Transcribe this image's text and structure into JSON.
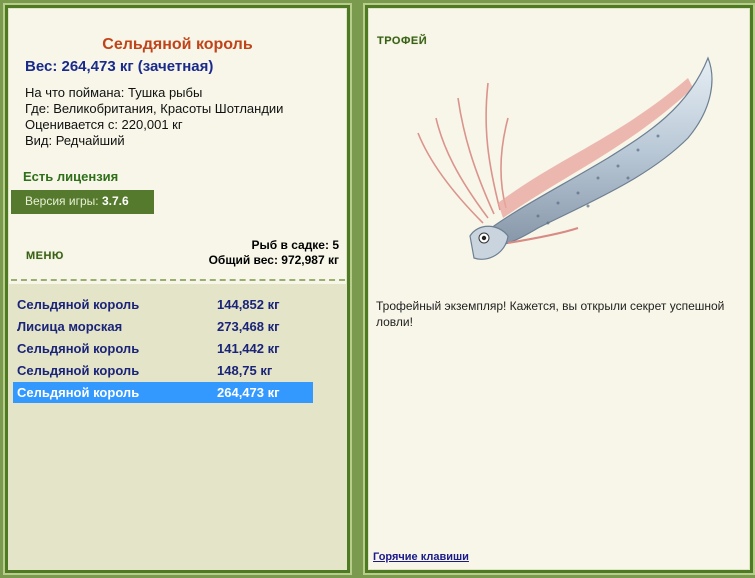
{
  "fish": {
    "name": "Сельдяной король",
    "weight": "Вес: 264,473 кг (зачетная)",
    "bait": "На что поймана: Тушка рыбы",
    "location": "Где: Великобритания, Красоты Шотландии",
    "value": "Оценивается с: 220,001 кг",
    "rarity": "Вид: Редчайший"
  },
  "license": "Есть лицензия",
  "version": {
    "label": "Версия игры:",
    "number": "3.7.6"
  },
  "menu_label": "МЕНЮ",
  "net": {
    "count": "Рыб в садке: 5",
    "total": "Общий вес: 972,987 кг"
  },
  "catches": [
    {
      "name": "Сельдяной король",
      "weight": "144,852 кг"
    },
    {
      "name": "Лисица морская",
      "weight": "273,468 кг"
    },
    {
      "name": "Сельдяной король",
      "weight": "141,442 кг"
    },
    {
      "name": "Сельдяной король",
      "weight": "148,75 кг"
    },
    {
      "name": "Сельдяной король",
      "weight": "264,473 кг"
    }
  ],
  "selected_catch_index": 4,
  "trophy": {
    "label": "ТРОФЕЙ",
    "text": "Трофейный экземпляр! Кажется, вы открыли секрет успешной ловли!"
  },
  "hotkeys": "Горячие клавиши",
  "colors": {
    "frame": "#4f7a24",
    "panel": "#f7f6e8",
    "accent_title": "#c0441a",
    "selection": "#3399ff",
    "link": "#1a1a8c"
  },
  "icons": {
    "fish_image": "oarfish-image"
  }
}
